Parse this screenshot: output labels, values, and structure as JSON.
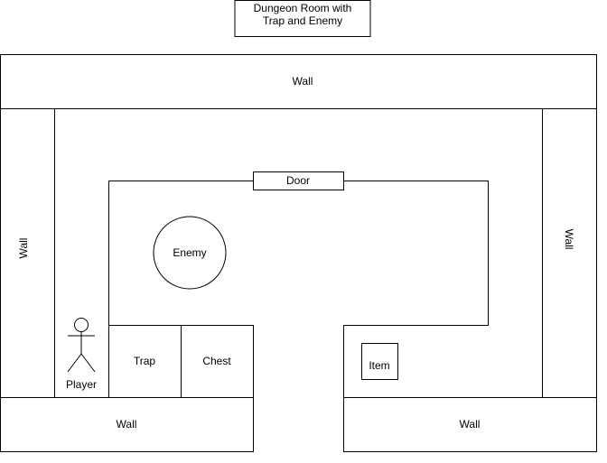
{
  "title": {
    "line1": "Dungeon Room with",
    "line2": "Trap and Enemy"
  },
  "walls": {
    "top": "Wall",
    "left": "Wall",
    "right": "Wall",
    "bottom_left": "Wall",
    "bottom_right": "Wall"
  },
  "door": "Door",
  "enemy": "Enemy",
  "player": "Player",
  "trap": "Trap",
  "chest": "Chest",
  "item": "Item",
  "colors": {
    "stroke": "#000000",
    "fill": "#ffffff",
    "text": "#000000"
  }
}
